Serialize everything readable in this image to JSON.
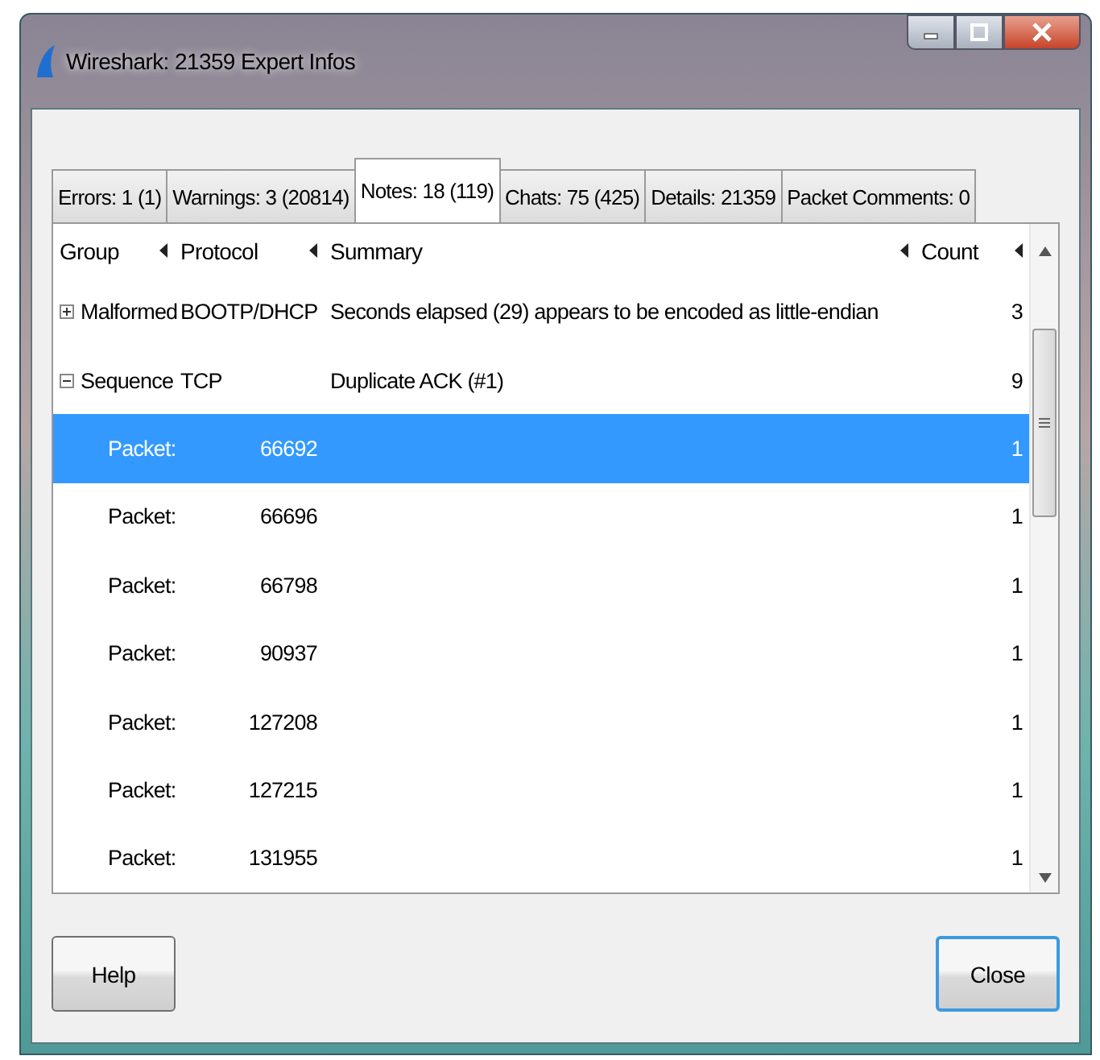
{
  "window": {
    "title": "Wireshark: 21359 Expert Infos"
  },
  "tabs": [
    {
      "label": "Errors: 1 (1)",
      "selected": false
    },
    {
      "label": "Warnings: 3 (20814)",
      "selected": false
    },
    {
      "label": "Notes: 18 (119)",
      "selected": true
    },
    {
      "label": "Chats: 75 (425)",
      "selected": false
    },
    {
      "label": "Details: 21359",
      "selected": false
    },
    {
      "label": "Packet Comments: 0",
      "selected": false
    }
  ],
  "table": {
    "columns": [
      "Group",
      "Protocol",
      "Summary",
      "Count"
    ],
    "rows": [
      {
        "group": "Malformed",
        "protocol": "BOOTP/DHCP",
        "summary": "Seconds elapsed (29) appears to be encoded as little-endian",
        "count": "3",
        "expanded": false,
        "selected": false
      },
      {
        "group": "Sequence",
        "protocol": "TCP",
        "summary": "Duplicate ACK (#1)",
        "count": "9",
        "expanded": true,
        "selected": false,
        "children": [
          {
            "group": "Packet:",
            "packet": "66692",
            "count": "1",
            "selected": true
          },
          {
            "group": "Packet:",
            "packet": "66696",
            "count": "1",
            "selected": false
          },
          {
            "group": "Packet:",
            "packet": "66798",
            "count": "1",
            "selected": false
          },
          {
            "group": "Packet:",
            "packet": "90937",
            "count": "1",
            "selected": false
          },
          {
            "group": "Packet:",
            "packet": "127208",
            "count": "1",
            "selected": false
          },
          {
            "group": "Packet:",
            "packet": "127215",
            "count": "1",
            "selected": false
          },
          {
            "group": "Packet:",
            "packet": "131955",
            "count": "1",
            "selected": false
          }
        ]
      }
    ]
  },
  "buttons": [
    {
      "label": "Help",
      "default": false
    },
    {
      "label": "Close",
      "default": true
    }
  ]
}
